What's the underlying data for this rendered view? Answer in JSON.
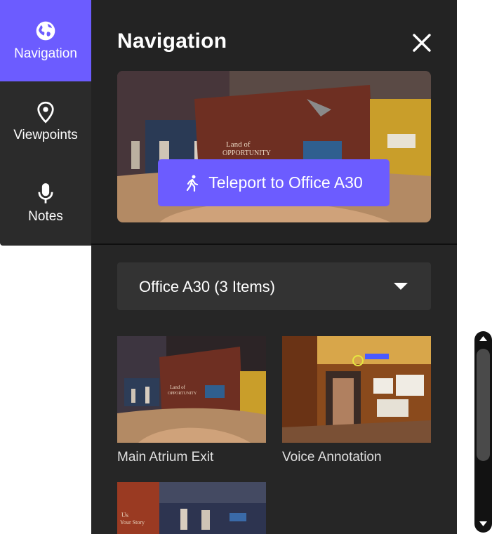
{
  "sidebar": {
    "items": [
      {
        "label": "Navigation",
        "icon": "globe-icon",
        "active": true
      },
      {
        "label": "Viewpoints",
        "icon": "location-pin-icon",
        "active": false
      },
      {
        "label": "Notes",
        "icon": "microphone-icon",
        "active": false
      }
    ]
  },
  "panel": {
    "title": "Navigation",
    "close_icon": "close-icon",
    "teleport_label": "Teleport to Office A30",
    "teleport_icon": "walking-person-icon",
    "dropdown": {
      "label": "Office A30  (3 Items)",
      "icon": "caret-down-icon"
    },
    "cards": [
      {
        "caption": "Main Atrium Exit"
      },
      {
        "caption": "Voice Annotation"
      },
      {
        "caption": ""
      }
    ]
  },
  "colors": {
    "accent": "#6c5cff",
    "panel_bg": "#262626",
    "rail_bg": "#2b2b2b"
  }
}
